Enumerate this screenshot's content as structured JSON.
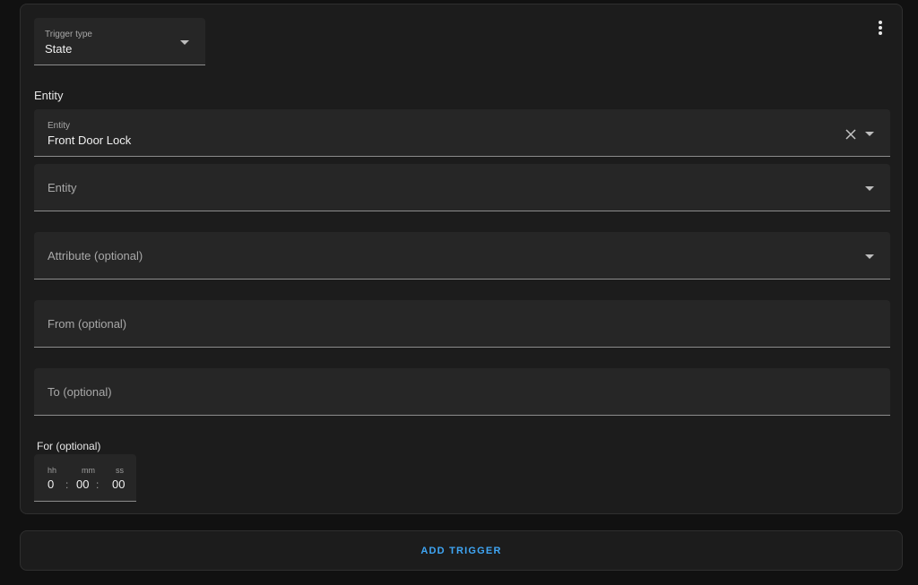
{
  "trigger_type": {
    "label": "Trigger type",
    "value": "State"
  },
  "entity_section": {
    "label": "Entity"
  },
  "entity_select": {
    "label": "Entity",
    "value": "Front Door Lock"
  },
  "entity_add": {
    "placeholder": "Entity"
  },
  "attribute": {
    "placeholder": "Attribute (optional)"
  },
  "from": {
    "placeholder": "From (optional)"
  },
  "to": {
    "placeholder": "To (optional)"
  },
  "for": {
    "label": "For (optional)",
    "hh_label": "hh",
    "mm_label": "mm",
    "ss_label": "ss",
    "hh": "0",
    "mm": "00",
    "ss": "00",
    "separator": ":"
  },
  "add_trigger": {
    "label": "ADD TRIGGER"
  },
  "icons": {
    "menu": "dots-vertical-icon",
    "clear": "close-icon",
    "dropdown": "menu-down-icon"
  },
  "colors": {
    "accent": "#3fa6f5",
    "card": "#1c1c1c",
    "field": "#262626"
  }
}
